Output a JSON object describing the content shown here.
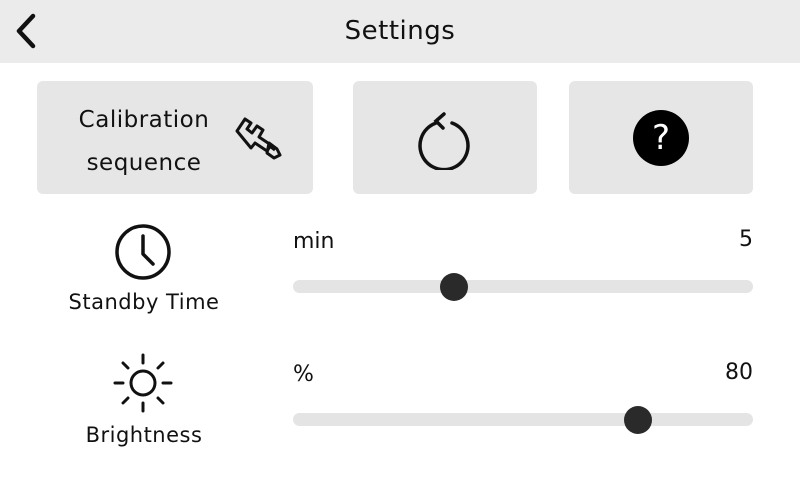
{
  "header": {
    "title": "Settings",
    "back_icon": "chevron-left-icon"
  },
  "actions": {
    "calibration": {
      "label_line1": "Calibration",
      "label_line2": "sequence",
      "icon": "wrench-caliper-icon"
    },
    "reset": {
      "icon": "rotate-icon"
    },
    "help": {
      "icon": "question-icon",
      "glyph": "?"
    }
  },
  "settings": {
    "standby": {
      "label": "Standby Time",
      "icon": "clock-icon",
      "unit": "min",
      "value": "5",
      "level": 0.35
    },
    "brightness": {
      "label": "Brightness",
      "icon": "sun-icon",
      "unit": "%",
      "value": "80",
      "level": 0.75
    }
  },
  "colors": {
    "header_bg": "#ebebeb",
    "tile_bg": "#e6e6e6",
    "track": "#e4e4e4",
    "thumb": "#2a2a2a"
  }
}
